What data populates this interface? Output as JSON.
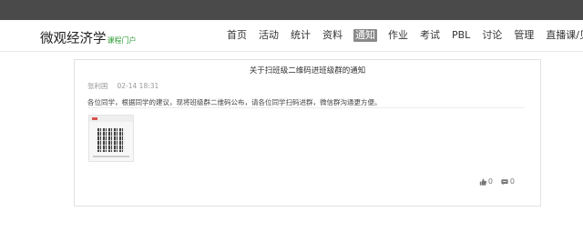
{
  "site": {
    "brand": "微观经济学",
    "brand_sub": "课程门户"
  },
  "nav": {
    "items": [
      {
        "label": "首页"
      },
      {
        "label": "活动"
      },
      {
        "label": "统计"
      },
      {
        "label": "资料"
      },
      {
        "label": "通知",
        "active": true
      },
      {
        "label": "作业"
      },
      {
        "label": "考试"
      },
      {
        "label": "PBL"
      },
      {
        "label": "讨论"
      },
      {
        "label": "管理"
      },
      {
        "label": "直播课/见面课"
      }
    ]
  },
  "notice": {
    "title": "关于扫班级二维码进班级群的通知",
    "author": "张利国",
    "time": "02-14 18:31",
    "body": "各位同学，根据同学的建议，现将班级群二维码公布，请各位同学扫码进群，微信群沟通更方便。",
    "likes": "0",
    "comments": "0"
  },
  "colors": {
    "topbar": "#4a4a4a",
    "brand_sub": "#2e9b34",
    "nav_active_bg": "#8a8a8a"
  }
}
